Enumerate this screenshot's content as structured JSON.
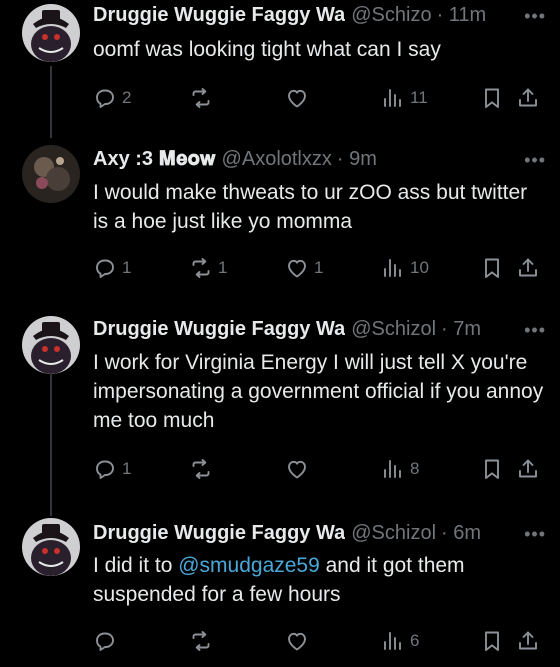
{
  "tweets": [
    {
      "name": "Druggie Wuggie Faggy Wa",
      "handle": "@Schizo",
      "time": "· 11m",
      "text": "oomf was looking tight what can I say",
      "replies": "2",
      "retweets": "",
      "likes": "",
      "views": "11",
      "avatar": "hat-avatar"
    },
    {
      "name": "Axy :3 𝐌𝐞𝐨𝐰",
      "handle": "@Axolotlxzx",
      "time": "· 9m",
      "text": "I would make thweats to ur zOO ass but twitter is a hoe just like yo momma",
      "replies": "1",
      "retweets": "1",
      "likes": "1",
      "views": "10",
      "avatar": "dark-avatar"
    },
    {
      "name": "Druggie Wuggie Faggy Wa",
      "handle": "@Schizol",
      "time": "· 7m",
      "text": "I work for Virginia Energy I will just tell X you're impersonating a government official if you annoy me too much",
      "replies": "1",
      "retweets": "",
      "likes": "",
      "views": "8",
      "avatar": "hat-avatar"
    },
    {
      "name": "Druggie Wuggie Faggy Wa",
      "handle": "@Schizol",
      "time": "· 6m",
      "text_before": "I did it to ",
      "mention": "@smudgaze59",
      "text_after": " and it got them suspended for a few hours",
      "replies": "",
      "retweets": "",
      "likes": "",
      "views": "6",
      "avatar": "hat-avatar"
    }
  ],
  "more_glyph": "•••",
  "colors": {
    "background": "#000000",
    "text": "#e7e9ea",
    "muted": "#71767b",
    "link": "#4aa8d8"
  }
}
